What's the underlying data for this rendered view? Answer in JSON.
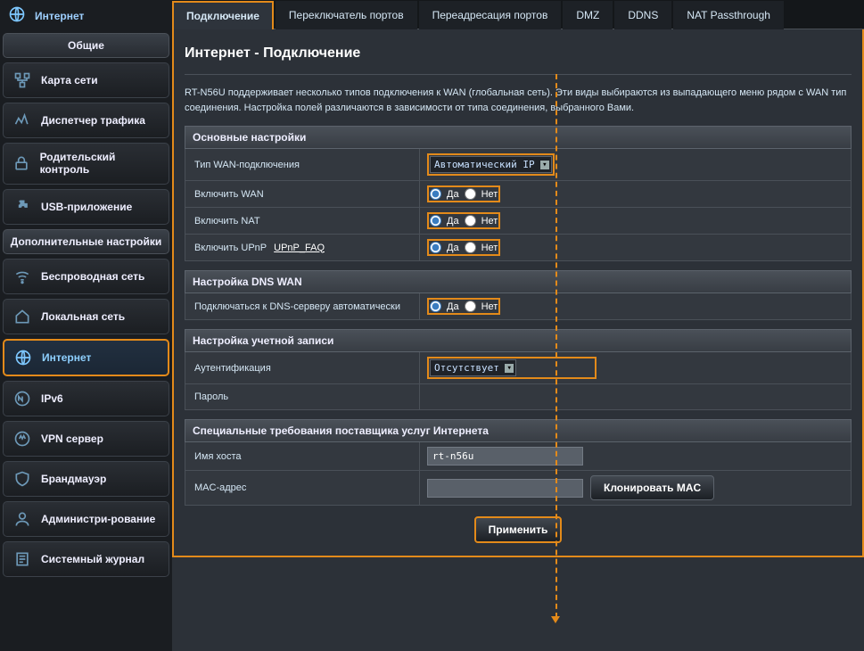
{
  "sidebar": {
    "top_active": "Интернет",
    "section1": "Общие",
    "items1": [
      {
        "label": "Карта сети"
      },
      {
        "label": "Диспетчер трафика"
      },
      {
        "label": "Родительский контроль"
      },
      {
        "label": "USB-приложение"
      }
    ],
    "section2": "Дополнительные настройки",
    "items2": [
      {
        "label": "Беспроводная сеть"
      },
      {
        "label": "Локальная сеть"
      },
      {
        "label": "Интернет"
      },
      {
        "label": "IPv6"
      },
      {
        "label": "VPN сервер"
      },
      {
        "label": "Брандмауэр"
      },
      {
        "label": "Администри-рование"
      },
      {
        "label": "Системный журнал"
      }
    ]
  },
  "tabs": [
    "Подключение",
    "Переключатель портов",
    "Переадресация портов",
    "DMZ",
    "DDNS",
    "NAT Passthrough"
  ],
  "page": {
    "title": "Интернет - Подключение",
    "desc": "RT-N56U поддерживает несколько типов подключения к WAN (глобальная сеть). Эти виды выбираются из выпадающего меню рядом с WAN тип соединения. Настройка полей различаются в зависимости от типа соединения, выбранного Вами."
  },
  "sections": {
    "basic": "Основные настройки",
    "dns": "Настройка DNS WAN",
    "account": "Настройка учетной записи",
    "isp": "Специальные требования поставщика услуг Интернета"
  },
  "fields": {
    "wan_type_label": "Тип WAN-подключения",
    "wan_type_value": "Автоматический IP",
    "enable_wan": "Включить WAN",
    "enable_nat": "Включить NAT",
    "enable_upnp": "Включить UPnP",
    "upnp_faq": "UPnP_FAQ",
    "dns_auto": "Подключаться к DNS-серверу автоматически",
    "auth_label": "Аутентификация",
    "auth_value": "Отсутствует",
    "password": "Пароль",
    "host": "Имя хоста",
    "host_value": "rt-n56u",
    "mac": "MAC-адрес",
    "yes": "Да",
    "no": "Нет",
    "clone_mac": "Клонировать MAC",
    "apply": "Применить"
  }
}
